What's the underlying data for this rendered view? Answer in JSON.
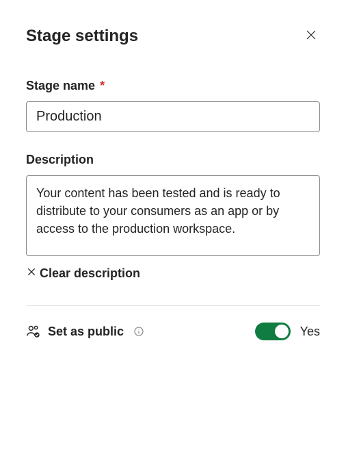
{
  "header": {
    "title": "Stage settings"
  },
  "stageName": {
    "label": "Stage name",
    "required": "*",
    "value": "Production"
  },
  "description": {
    "label": "Description",
    "value": "Your content has been tested and is ready to distribute to your consumers as an app or by access to the production workspace.",
    "clearLabel": "Clear description"
  },
  "public": {
    "label": "Set as public",
    "value": "Yes",
    "on": true
  }
}
